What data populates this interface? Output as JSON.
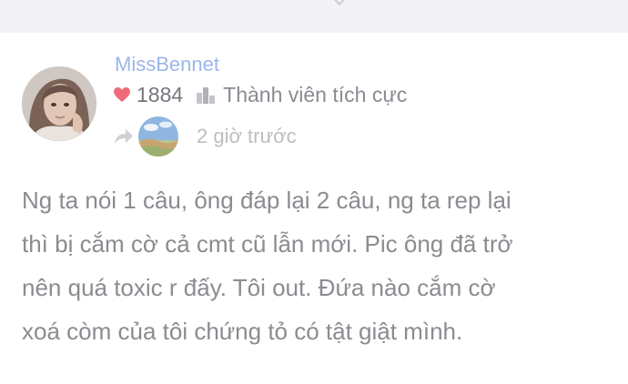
{
  "post": {
    "author": {
      "username": "MissBennet",
      "likes": "1884",
      "rank": "Thành viên tích cực",
      "avatar_icon": "profile-photo",
      "username_color": "#9cb6ea"
    },
    "reply": {
      "icon": "share-arrow-icon",
      "avatar_icon": "landscape-photo",
      "time": "2 giờ trước"
    },
    "comment_lines": [
      "Ng ta nói 1 câu, ông đáp lại 2 câu, ng ta rep lại",
      "thì bị cắm cờ cả cmt cũ lẫn mới. Pic ông đã trở",
      "nên quá toxic r đấy. Tôi out. Đứa nào cắm cờ",
      "xoá còm của tôi chứng tỏ có tật giật mình."
    ]
  },
  "colors": {
    "heart": "#f06b7a",
    "text": "#8b8b91",
    "muted": "#bdbdc3"
  }
}
